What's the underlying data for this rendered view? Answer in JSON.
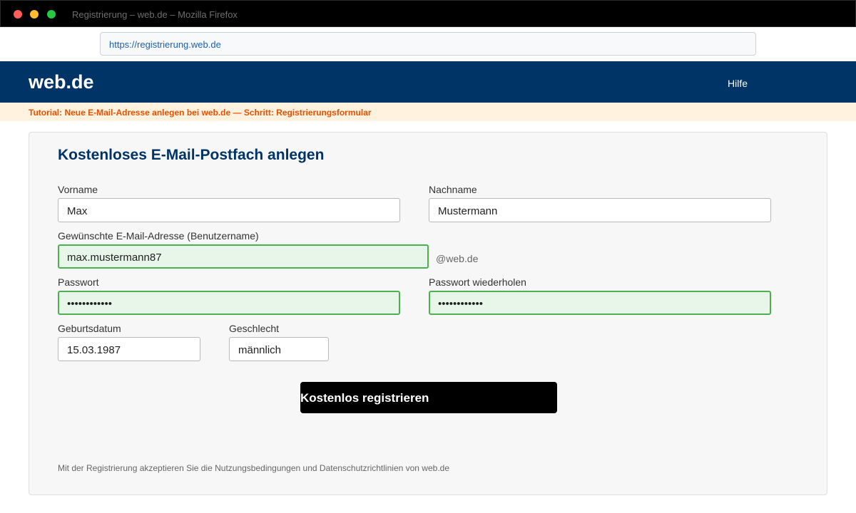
{
  "browser": {
    "window_title": "Registrierung – web.de – Mozilla Firefox",
    "url": "https://registrierung.web.de"
  },
  "header": {
    "logo": "web.de",
    "help_label": "Hilfe"
  },
  "tutorial": {
    "text": "Tutorial: Neue E-Mail-Adresse anlegen bei web.de — Schritt: Registrierungsformular"
  },
  "form": {
    "title": "Kostenloses E-Mail-Postfach anlegen",
    "first_name": {
      "label": "Vorname",
      "value": "Max"
    },
    "last_name": {
      "label": "Nachname",
      "value": "Mustermann"
    },
    "email": {
      "label": "Gewünschte E-Mail-Adresse (Benutzername)",
      "value": "max.mustermann87",
      "suffix": "@web.de"
    },
    "password": {
      "label": "Passwort",
      "value": "••••••••••••"
    },
    "password_repeat": {
      "label": "Passwort wiederholen",
      "value": "••••••••••••"
    },
    "birthdate": {
      "label": "Geburtsdatum",
      "value": "15.03.1987"
    },
    "gender": {
      "label": "Geschlecht",
      "value": "männlich"
    },
    "submit_label": "Kostenlos registrieren",
    "terms_text": "Mit der Registrierung akzeptieren Sie die Nutzungsbedingungen und Datenschutzrichtlinien von web.de"
  },
  "colors": {
    "brand": "#003366",
    "tutorial_accent": "#e65100",
    "valid_border": "#4caf50",
    "valid_fill": "#e8f5e9"
  }
}
